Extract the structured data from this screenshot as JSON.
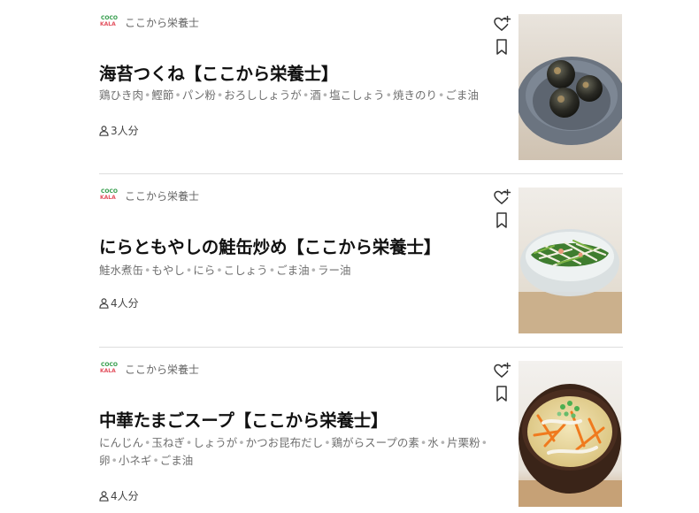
{
  "recipes": [
    {
      "author": "ここから栄養士",
      "title": "海苔つくね【ここから栄養士】",
      "ingredients": [
        "鶏ひき肉",
        "鰹節",
        "パン粉",
        "おろししょうが",
        "酒",
        "塩こしょう",
        "焼きのり",
        "ごま油"
      ],
      "servings": "3人分"
    },
    {
      "author": "ここから栄養士",
      "title": "にらともやしの鮭缶炒め【ここから栄養士】",
      "ingredients": [
        "鮭水煮缶",
        "もやし",
        "にら",
        "こしょう",
        "ごま油",
        "ラー油"
      ],
      "servings": "4人分"
    },
    {
      "author": "ここから栄養士",
      "title": "中華たまごスープ【ここから栄養士】",
      "ingredients": [
        "にんじん",
        "玉ねぎ",
        "しょうが",
        "かつお昆布だし",
        "鶏がらスープの素",
        "水",
        "片栗粉",
        "卵",
        "小ネギ",
        "ごま油"
      ],
      "servings": "4人分"
    }
  ],
  "logo": {
    "top_text": "COCO",
    "bottom_text": "KALA"
  },
  "ingredient_separator": "•",
  "colors": {
    "logo_green": "#2f9b47",
    "logo_red": "#e3525f",
    "divider": "#dddddd",
    "icon": "#333333"
  },
  "icons": {
    "add_to_collection": "heart-plus-icon",
    "bookmark": "bookmark-icon",
    "servings": "person-icon"
  }
}
